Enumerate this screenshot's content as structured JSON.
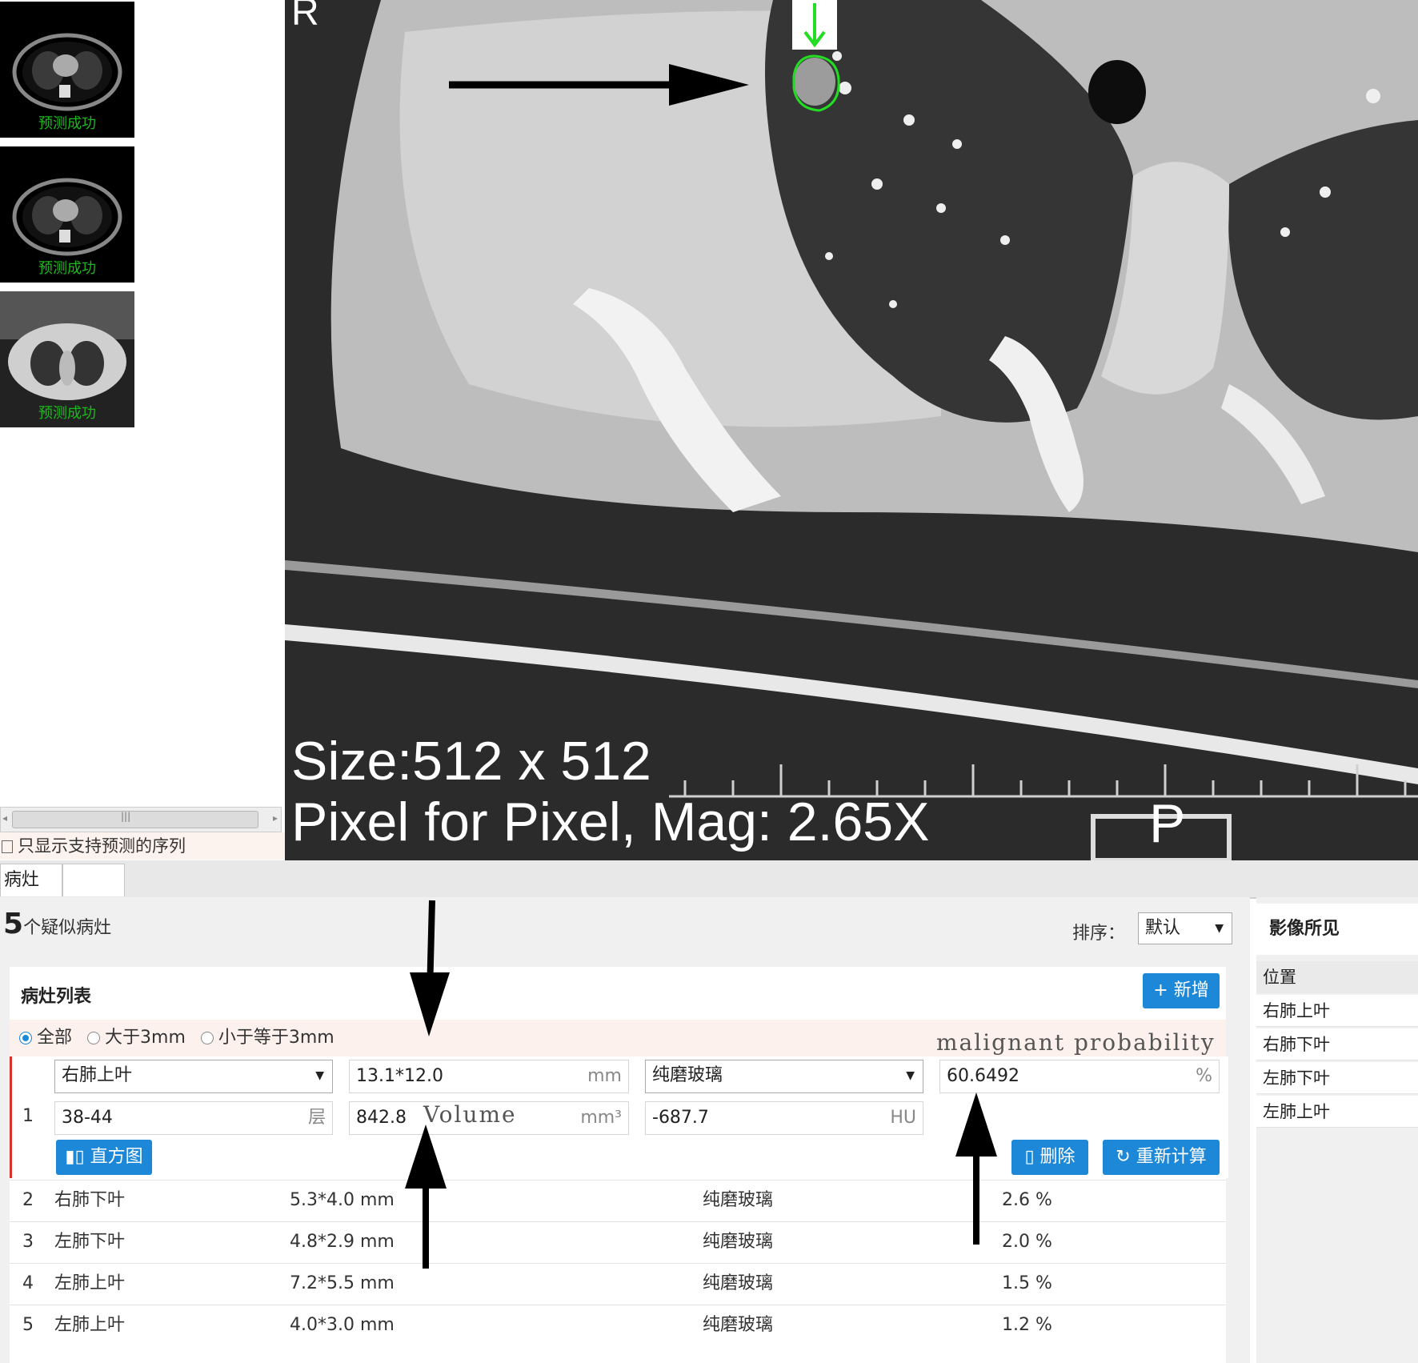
{
  "thumbnails": [
    {
      "caption": "预测成功"
    },
    {
      "caption": "预测成功"
    },
    {
      "caption": "预测成功"
    }
  ],
  "series_filter": {
    "label": "只显示支持预测的序列"
  },
  "viewer": {
    "orientation_top": "R",
    "orientation_bottom": "P",
    "size_text": "Size:512 x 512",
    "mag_text": "Pixel for Pixel, Mag: 2.65X"
  },
  "tabs": [
    {
      "label": "病灶"
    },
    {
      "label": ""
    }
  ],
  "summary": {
    "count": "5",
    "count_label": "个疑似病灶"
  },
  "sort": {
    "label": "排序：",
    "value": "默认"
  },
  "lesion_list": {
    "title": "病灶列表",
    "add_label": "+ 新增"
  },
  "filters": [
    {
      "label": "全部",
      "selected": true
    },
    {
      "label": "大于3mm",
      "selected": false
    },
    {
      "label": "小于等于3mm",
      "selected": false
    }
  ],
  "annotations": {
    "malignant": "malignant probability",
    "volume": "Volume"
  },
  "selected_lesion": {
    "index": "1",
    "location": "右肺上叶",
    "size": "13.1*12.0",
    "size_unit": "mm",
    "density": "纯磨玻璃",
    "probability": "60.6492",
    "probability_unit": "%",
    "slices": "38-44",
    "slices_unit": "层",
    "volume": "842.8",
    "volume_unit": "mm³",
    "hu": "-687.7",
    "hu_unit": "HU",
    "histogram_label": "直方图",
    "delete_label": "删除",
    "recalc_label": "重新计算"
  },
  "lesions": [
    {
      "index": "2",
      "location": "右肺下叶",
      "size": "5.3*4.0 mm",
      "density": "纯磨玻璃",
      "probability": "2.6 %"
    },
    {
      "index": "3",
      "location": "左肺下叶",
      "size": "4.8*2.9 mm",
      "density": "纯磨玻璃",
      "probability": "2.0 %"
    },
    {
      "index": "4",
      "location": "左肺上叶",
      "size": "7.2*5.5 mm",
      "density": "纯磨玻璃",
      "probability": "1.5 %"
    },
    {
      "index": "5",
      "location": "左肺上叶",
      "size": "4.0*3.0 mm",
      "density": "纯磨玻璃",
      "probability": "1.2 %"
    }
  ],
  "findings": {
    "title": "影像所见",
    "column": "位置",
    "items": [
      "右肺上叶",
      "右肺下叶",
      "左肺下叶",
      "左肺上叶"
    ]
  },
  "colors": {
    "accent": "#1e88d8",
    "contour": "#22dd22",
    "caption": "#1db81d"
  }
}
